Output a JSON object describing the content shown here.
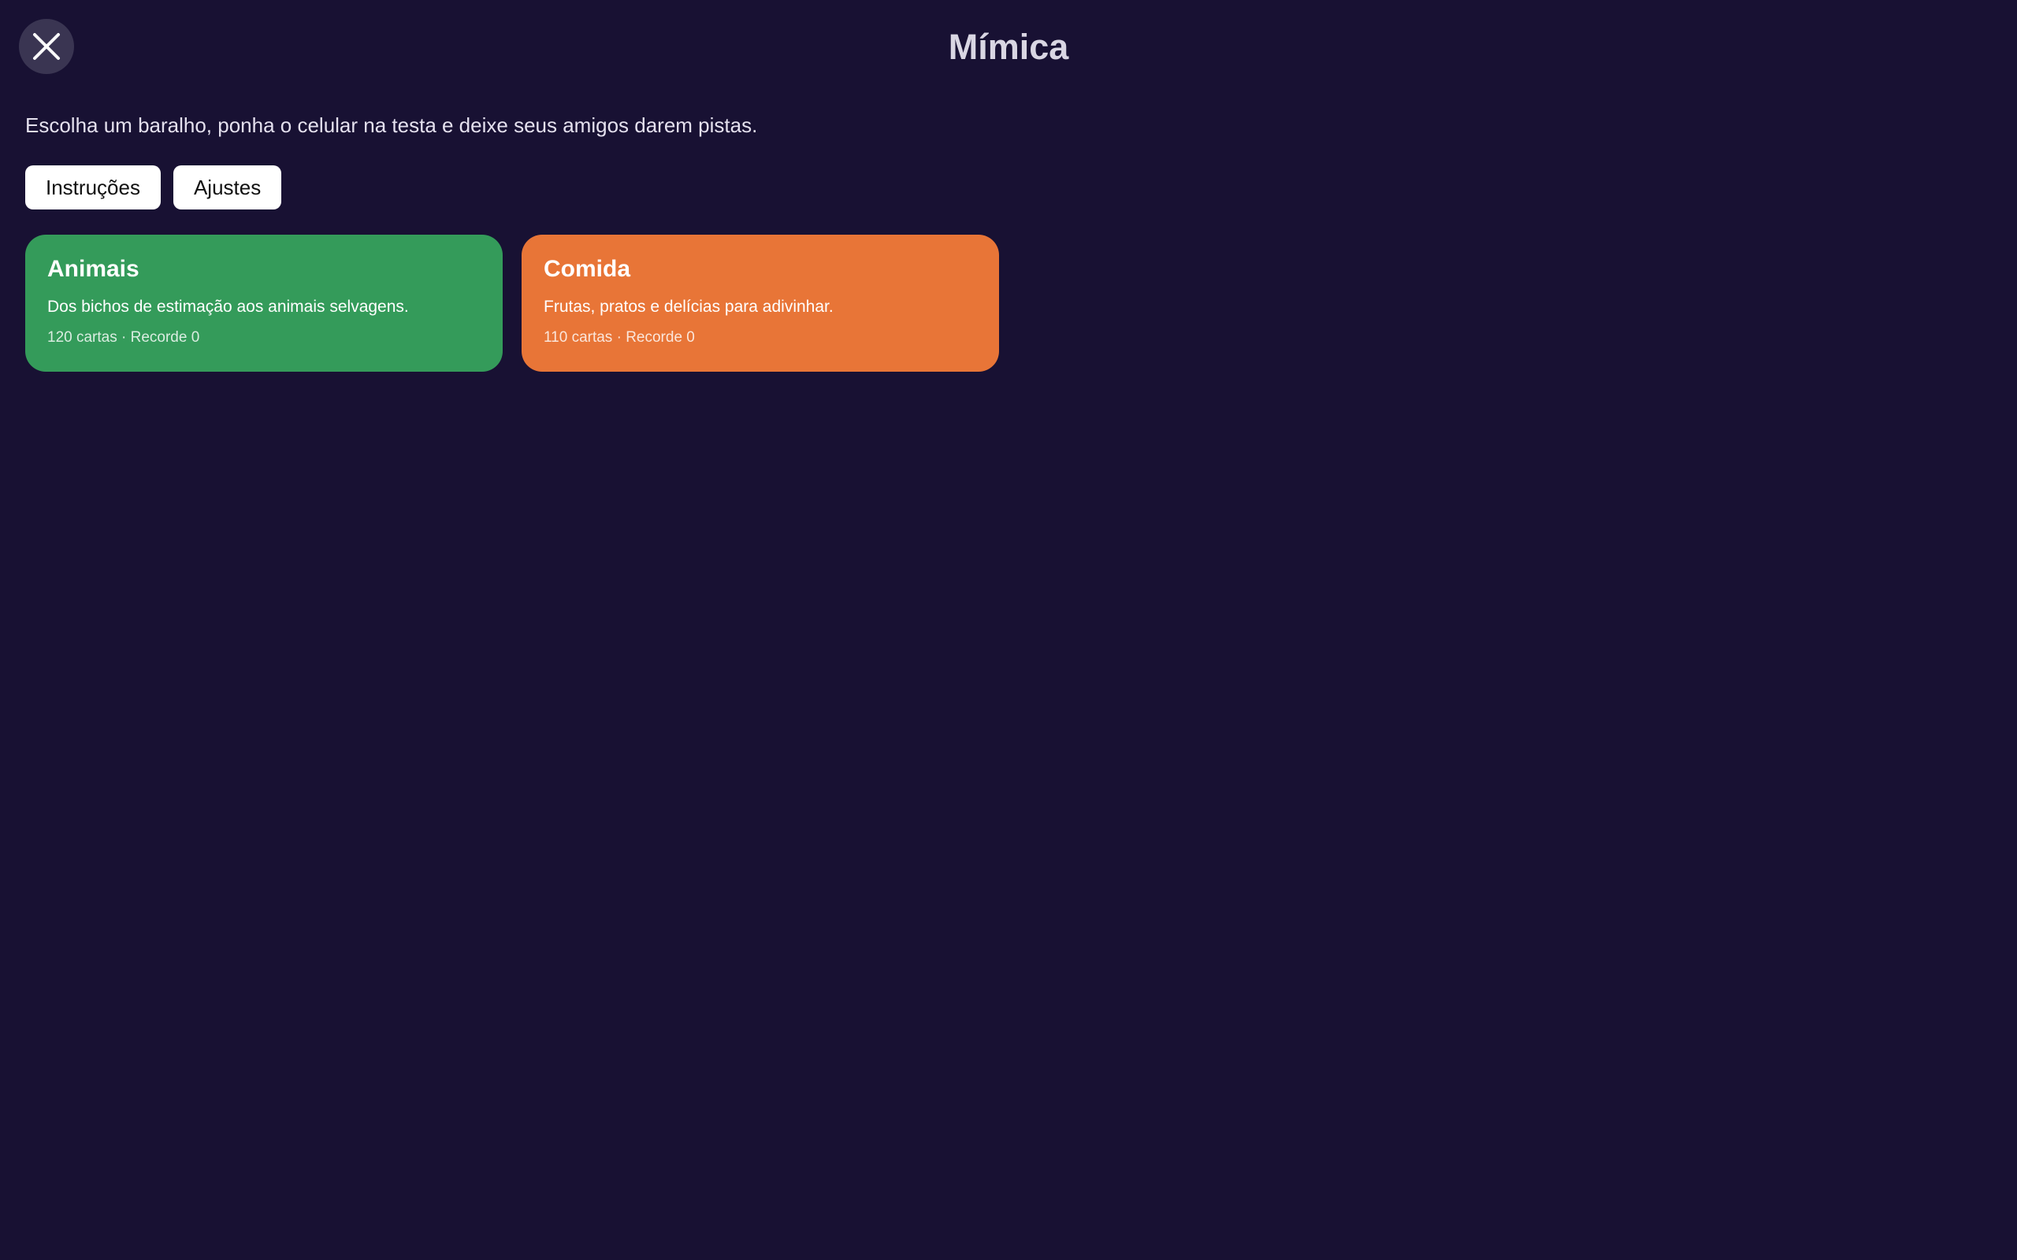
{
  "header": {
    "title": "Mímica",
    "close_icon": "close-icon"
  },
  "intro": {
    "text": "Escolha um baralho, ponha o celular na testa e deixe seus amigos darem pistas."
  },
  "actions": {
    "instructions_label": "Instruções",
    "settings_label": "Ajustes"
  },
  "decks": [
    {
      "title": "Animais",
      "description": "Dos bichos de estimação aos animais selvagens.",
      "meta": "120 cartas · Recorde 0",
      "color": "#349b5a"
    },
    {
      "title": "Comida",
      "description": "Frutas, pratos e delícias para adivinhar.",
      "meta": "110 cartas · Recorde 0",
      "color": "#e87537"
    }
  ],
  "colors": {
    "background": "#181133",
    "close_button": "#3a3552"
  }
}
